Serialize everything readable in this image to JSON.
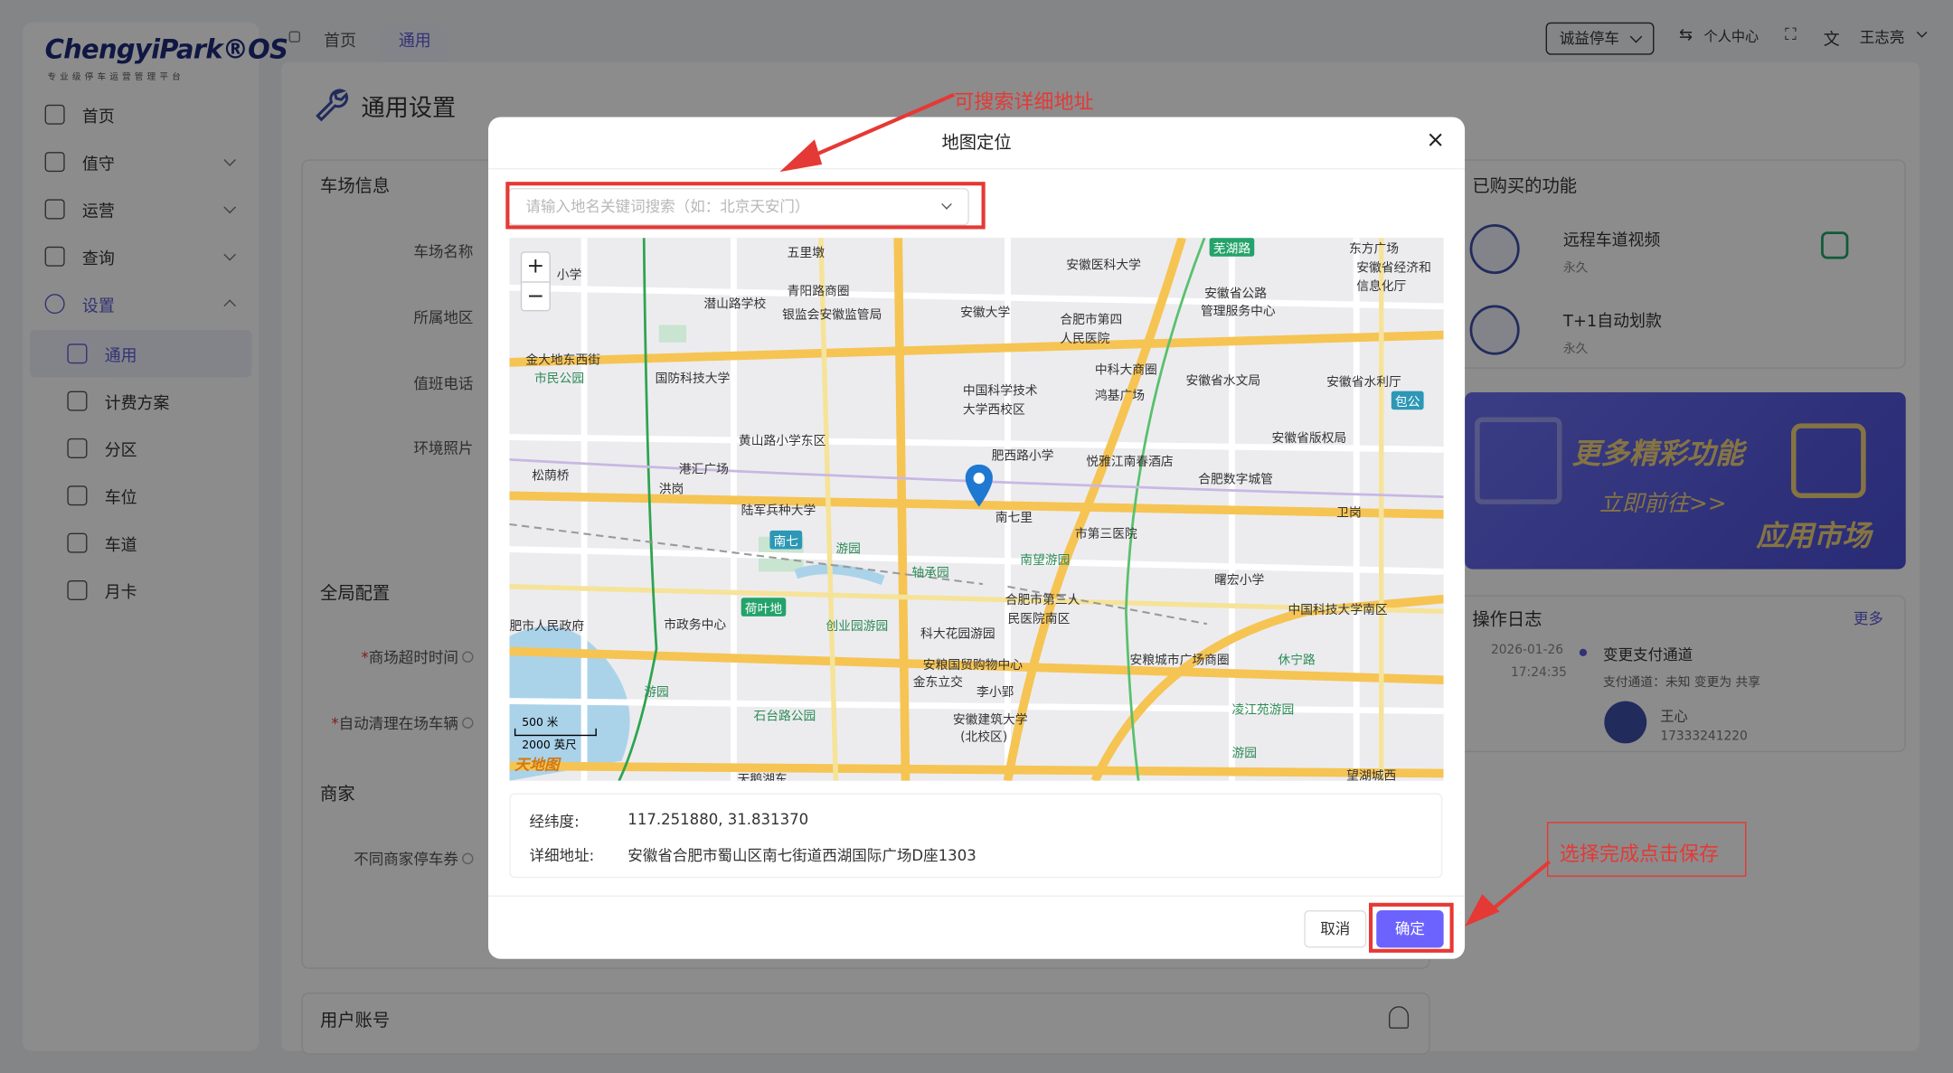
{
  "app": {
    "logo": "ChengyiPark®OS",
    "logo_sub": "专业级停车运营管理平台"
  },
  "sidebar": {
    "items": [
      {
        "label": "首页"
      },
      {
        "label": "值守"
      },
      {
        "label": "运营"
      },
      {
        "label": "查询"
      },
      {
        "label": "设置"
      },
      {
        "label": "通用"
      },
      {
        "label": "计费方案"
      },
      {
        "label": "分区"
      },
      {
        "label": "车位"
      },
      {
        "label": "车道"
      },
      {
        "label": "月卡"
      }
    ]
  },
  "header": {
    "tabs": [
      {
        "label": "首页"
      },
      {
        "label": "通用"
      }
    ],
    "parking_select": "诚益停车",
    "personal_center": "个人中心",
    "user": "王志亮"
  },
  "page": {
    "title": "通用设置",
    "sections": {
      "parking_info": "车场信息",
      "global_config": "全局配置",
      "merchant": "商家",
      "user_account": "用户账号"
    },
    "fields": {
      "parking_name": "车场名称",
      "region": "所属地区",
      "duty_phone": "值班电话",
      "env_photo": "环境照片",
      "mall_timeout": "商场超时时间",
      "auto_clear": "自动清理在场车辆",
      "merchant_coupon": "不同商家停车券"
    }
  },
  "right_panel": {
    "purchased_title": "已购买的功能",
    "features": [
      {
        "name": "远程车道视频",
        "term": "永久"
      },
      {
        "name": "T+1自动划款",
        "term": "永久"
      }
    ],
    "banner": {
      "line1": "更多精彩功能",
      "line2": "立即前往>>",
      "line3": "应用市场"
    },
    "log": {
      "title": "操作日志",
      "more": "更多",
      "date": "2026-01-26",
      "time": "17:24:35",
      "event": "变更支付通道",
      "detail": "支付通道：未知 变更为 共享",
      "user_name": "王心",
      "user_phone": "17333241220"
    }
  },
  "modal": {
    "title": "地图定位",
    "close": "×",
    "search_placeholder": "请输入地名关键词搜索（如：北京天安门）",
    "zoom_in": "+",
    "zoom_out": "−",
    "map_labels": [
      "五里墩",
      "安徽医科大学",
      "芜湖路",
      "东方广场",
      "安徽省经济和",
      "信息化厅",
      "小学",
      "青阳路商圈",
      "潜山路学校",
      "银监会安徽监管局",
      "安徽大学",
      "合肥市第四",
      "人民医院",
      "安徽省公路",
      "管理服务中心",
      "金大地东西街",
      "市民公园",
      "国防科技大学",
      "中科大商圈",
      "安徽省水文局",
      "安徽省水利厅",
      "包公",
      "中国科学技术",
      "大学西校区",
      "鸿基广场",
      "黄山路小学东区",
      "安徽省版权局",
      "港汇广场",
      "松荫桥",
      "洪岗",
      "肥西路小学",
      "悦雅江南春酒店",
      "合肥数字城管",
      "陆军兵种大学",
      "南七里",
      "卫岗",
      "南七",
      "市第三医院",
      "南望游园",
      "游园",
      "轴承园",
      "曙宏小学",
      "荷叶地",
      "合肥市第三人",
      "民医院南区",
      "中国科技大学南区",
      "肥市人民政府",
      "市政务中心",
      "创业园游园",
      "安粮城市广场商圈",
      "休宁路",
      "科大花园游园",
      "安粮国贸购物中心",
      "金东立交",
      "李小郢",
      "游园",
      "凌江苑游园",
      "石台路公园",
      "安徽建筑大学",
      "(北校区)",
      "游园",
      "望湖城西",
      "天鹅湖东"
    ],
    "scale_m": "500 米",
    "scale_ft": "2000 英尺",
    "map_brand": "天地图",
    "lnglat_label": "经纬度:",
    "lnglat_value": "117.251880, 31.831370",
    "address_label": "详细地址:",
    "address_value": "安徽省合肥市蜀山区南七街道西湖国际广场D座1303",
    "cancel": "取消",
    "ok": "确定"
  },
  "annotations": {
    "search_hint": "可搜索详细地址",
    "save_hint": "选择完成点击保存"
  },
  "colors": {
    "primary": "#6c63ff",
    "annotation": "#e53935",
    "accent_text": "#5b5bd6"
  }
}
